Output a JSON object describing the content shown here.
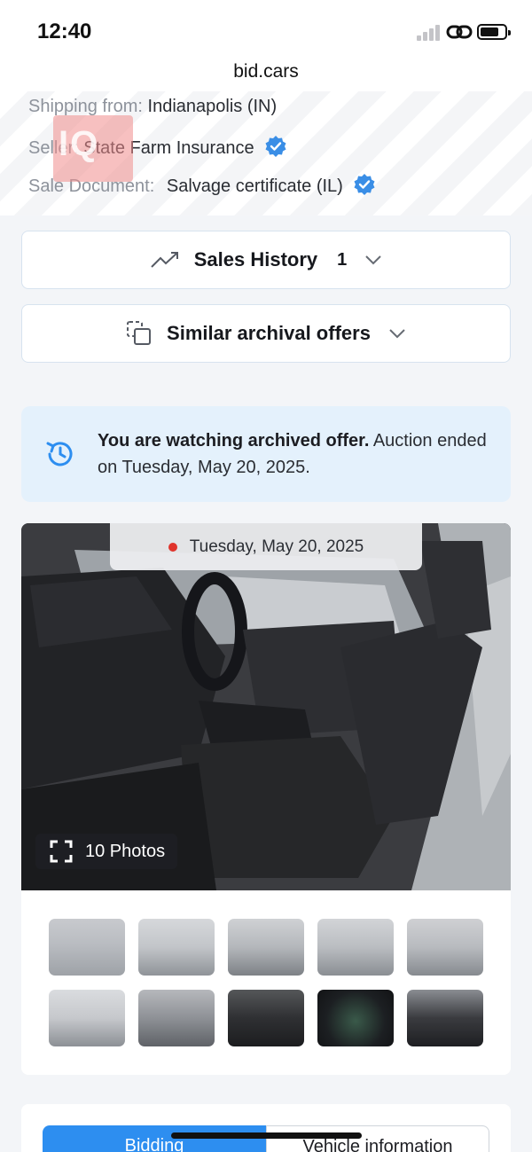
{
  "status_bar": {
    "time": "12:40",
    "icons": [
      "signal-icon",
      "link-icon",
      "battery-icon"
    ]
  },
  "browser": {
    "url": "bid.cars"
  },
  "vehicle_info": {
    "shipping_label": "Shipping from:",
    "shipping_value": "Indianapolis (IN)",
    "seller_label": "Seller:",
    "seller_value": "State Farm Insurance",
    "sale_document_label": "Sale Document:",
    "sale_document_value": "Salvage certificate (IL)"
  },
  "watermark": {
    "text": "IQ"
  },
  "sales_history": {
    "label": "Sales History",
    "count": "1"
  },
  "similar_offers": {
    "label": "Similar archival offers"
  },
  "notice": {
    "bold_text": "You are watching archived offer.",
    "text": " Auction ended on Tuesday, May 20, 2025."
  },
  "gallery": {
    "date": "Tuesday, May 20, 2025",
    "photos_label": "10 Photos",
    "thumbnail_count": 10
  },
  "tabs": {
    "bidding": "Bidding",
    "vehicle_information": "Vehicle information"
  },
  "colors": {
    "accent_blue": "#2d8ef0",
    "verified_blue": "#3a8ee6",
    "notice_bg": "#e4f1fc",
    "live_dot": "#e0342c"
  }
}
